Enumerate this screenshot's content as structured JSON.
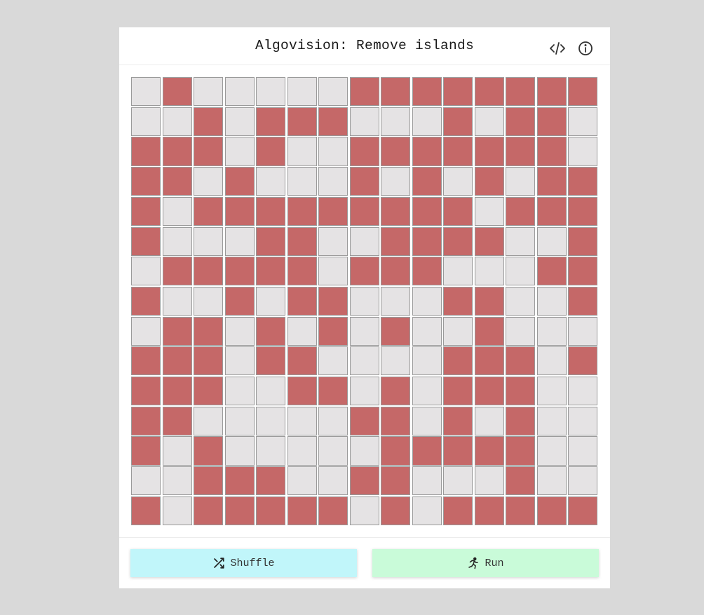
{
  "header": {
    "title": "Algovision: Remove islands",
    "icons": [
      "code-icon",
      "info-icon"
    ]
  },
  "colors": {
    "land": "#c56868",
    "water": "#e5e3e4",
    "shuffle_button": "#c1f6fa",
    "run_button": "#c9fbd9",
    "background": "#d9d9d9"
  },
  "grid": {
    "rows": 15,
    "cols": 15,
    "cells": [
      [
        0,
        1,
        0,
        0,
        0,
        0,
        0,
        1,
        1,
        1,
        1,
        1,
        1,
        1,
        1
      ],
      [
        0,
        0,
        1,
        0,
        1,
        1,
        1,
        0,
        0,
        0,
        1,
        0,
        1,
        1,
        0
      ],
      [
        1,
        1,
        1,
        0,
        1,
        0,
        0,
        1,
        1,
        1,
        1,
        1,
        1,
        1,
        0
      ],
      [
        1,
        1,
        0,
        1,
        0,
        0,
        0,
        1,
        0,
        1,
        0,
        1,
        0,
        1,
        1
      ],
      [
        1,
        0,
        1,
        1,
        1,
        1,
        1,
        1,
        1,
        1,
        1,
        0,
        1,
        1,
        1
      ],
      [
        1,
        0,
        0,
        0,
        1,
        1,
        0,
        0,
        1,
        1,
        1,
        1,
        0,
        0,
        1
      ],
      [
        0,
        1,
        1,
        1,
        1,
        1,
        0,
        1,
        1,
        1,
        0,
        0,
        0,
        1,
        1
      ],
      [
        1,
        0,
        0,
        1,
        0,
        1,
        1,
        0,
        0,
        0,
        1,
        1,
        0,
        0,
        1
      ],
      [
        0,
        1,
        1,
        0,
        1,
        0,
        1,
        0,
        1,
        0,
        0,
        1,
        0,
        0,
        0
      ],
      [
        1,
        1,
        1,
        0,
        1,
        1,
        0,
        0,
        0,
        0,
        1,
        1,
        1,
        0,
        1
      ],
      [
        1,
        1,
        1,
        0,
        0,
        1,
        1,
        0,
        1,
        0,
        1,
        1,
        1,
        0,
        0
      ],
      [
        1,
        1,
        0,
        0,
        0,
        0,
        0,
        1,
        1,
        0,
        1,
        0,
        1,
        0,
        0
      ],
      [
        1,
        0,
        1,
        0,
        0,
        0,
        0,
        0,
        1,
        1,
        1,
        1,
        1,
        0,
        0
      ],
      [
        0,
        0,
        1,
        1,
        1,
        0,
        0,
        1,
        1,
        0,
        0,
        0,
        1,
        0,
        0
      ],
      [
        1,
        0,
        1,
        1,
        1,
        1,
        1,
        0,
        1,
        0,
        1,
        1,
        1,
        1,
        1
      ]
    ]
  },
  "buttons": {
    "shuffle": {
      "label": "Shuffle",
      "icon": "shuffle-icon"
    },
    "run": {
      "label": "Run",
      "icon": "running-person-icon"
    }
  }
}
